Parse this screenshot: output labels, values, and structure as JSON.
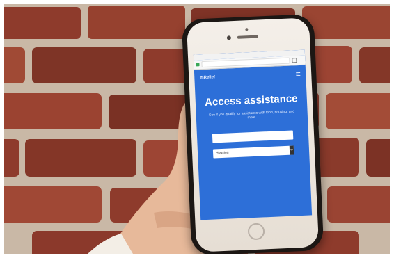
{
  "browser": {
    "status_text": "",
    "url": ""
  },
  "app": {
    "logo_text": "mRelief"
  },
  "hero": {
    "title": "Access assistance",
    "subtitle": "See if you qualify for assistance with food, housing, and more."
  },
  "form": {
    "zip_value": "",
    "category_value": "Housing"
  },
  "colors": {
    "screen_blue": "#2d6fd8",
    "brick": "#8e3b2c",
    "mortar": "#c9b8a6",
    "phone_body": "#1c1714"
  },
  "icons": [
    "lock-icon",
    "tabs-icon",
    "hamburger-icon",
    "chevron-down-icon"
  ]
}
